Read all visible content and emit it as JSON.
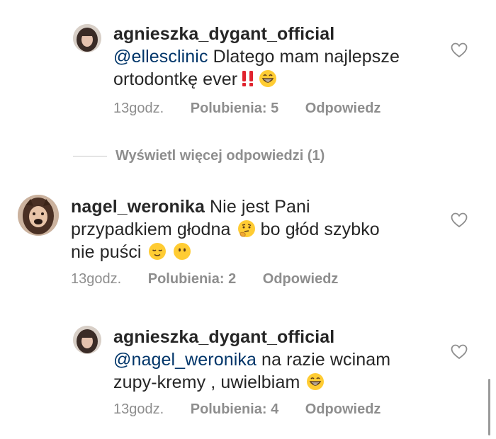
{
  "comments": [
    {
      "username": "agnieszka_dygant_official",
      "mention": "@ellesclinic",
      "text_line1": " Dlatego mam najlepsze",
      "text_line2": "ortodontkę ever",
      "emoji": [
        "double-exclamation-icon",
        "grinning-face-icon"
      ],
      "time": "13godz.",
      "likes": "Polubienia: 5",
      "reply": "Odpowiedz"
    },
    {
      "username": "nagel_weronika",
      "text_line1": " Nie jest Pani",
      "text_line2a": "przypadkiem głodna ",
      "text_line2b": " bo głód szybko",
      "text_line3": "nie puści ",
      "emoji": [
        "thinking-face-icon",
        "relieved-face-icon",
        "hushed-face-icon"
      ],
      "time": "13godz.",
      "likes": "Polubienia: 2",
      "reply": "Odpowiedz"
    },
    {
      "username": "agnieszka_dygant_official",
      "mention": "@nagel_weronika",
      "text_line1": " na razie wcinam",
      "text_line2": "zupy-kremy , uwielbiam ",
      "emoji": [
        "grinning-face-icon"
      ],
      "time": "13godz.",
      "likes": "Polubienia: 4",
      "reply": "Odpowiedz"
    }
  ],
  "more_replies": "Wyświetl więcej odpowiedzi (1)",
  "colors": {
    "text": "#262626",
    "meta": "#8e8e8e",
    "mention": "#003569",
    "exclamation": "#e0232e",
    "emoji_yellow": "#ffcc33"
  }
}
